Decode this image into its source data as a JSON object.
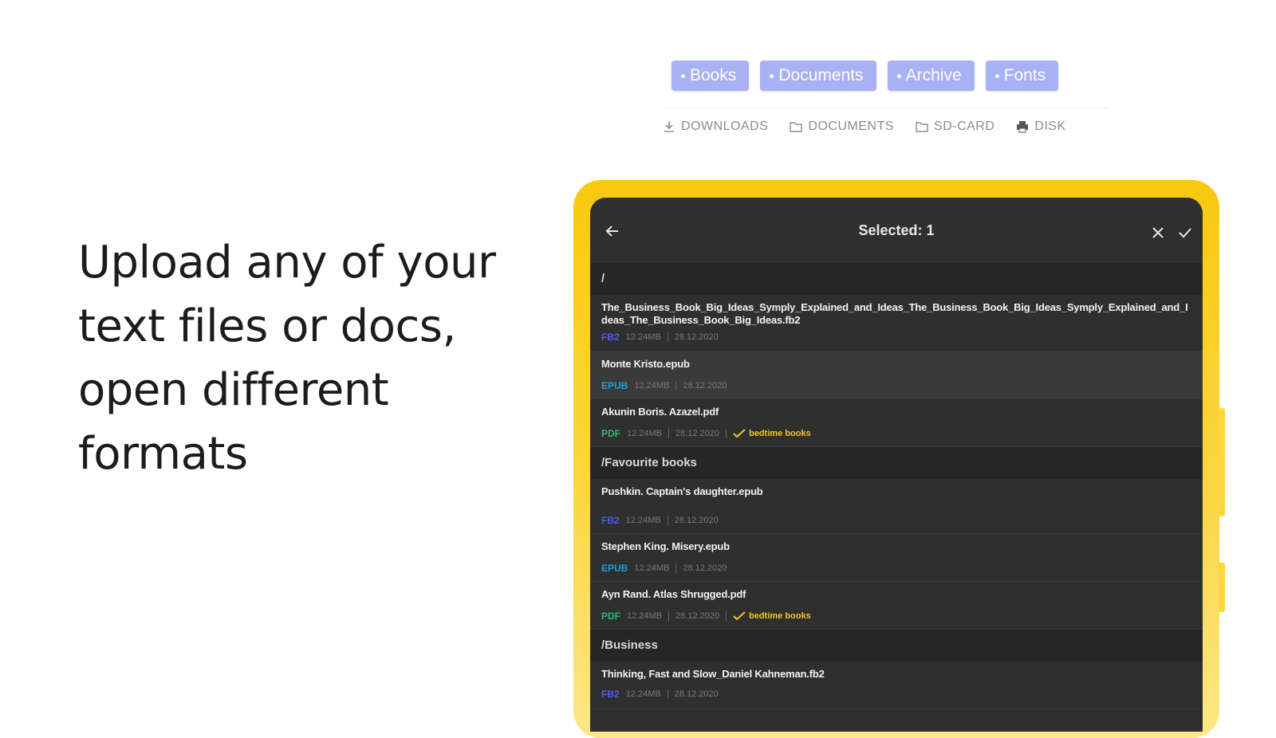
{
  "headline": {
    "lines": [
      "Upload any of your",
      "text files or docs,",
      "open different",
      "formats"
    ]
  },
  "categories": [
    "Books",
    "Documents",
    "Archive",
    "Fonts"
  ],
  "locations": [
    {
      "label": "DOWNLOADS",
      "icon": "download-icon"
    },
    {
      "label": "DOCUMENTS",
      "icon": "folder-icon"
    },
    {
      "label": "SD-CARD",
      "icon": "folder-icon"
    },
    {
      "label": "DISK",
      "icon": "printer-icon"
    }
  ],
  "app": {
    "title": "Selected: 1",
    "sections": [
      {
        "path": "/",
        "files": [
          {
            "name": "The_Business_Book_Big_Ideas_Symply_Explained_and_Ideas_The_Business_Book_Big_Ideas_Symply_Explained_and_Ideas_The_Business_Book_Big_Ideas.fb2",
            "format": "FB2",
            "size": "12.24MB",
            "date": "28.12.2020",
            "badge": ""
          },
          {
            "name": "Monte Kristo.epub",
            "format": "EPUB",
            "size": "12.24MB",
            "date": "28.12.2020",
            "badge": ""
          },
          {
            "name": "Akunin Boris. Azazel.pdf",
            "format": "PDF",
            "size": "12.24MB",
            "date": "28.12.2020",
            "badge": "bedtime books"
          }
        ]
      },
      {
        "path": "/Favourite books",
        "files": [
          {
            "name": "Pushkin. Captain's daughter.epub",
            "format": "FB2",
            "size": "12.24MB",
            "date": "28.12.2020",
            "badge": ""
          },
          {
            "name": "Stephen King. Misery.epub",
            "format": "EPUB",
            "size": "12.24MB",
            "date": "28.12.2020",
            "badge": ""
          },
          {
            "name": "Ayn Rand. Atlas Shrugged.pdf",
            "format": "PDF",
            "size": "12.24MB",
            "date": "28.12.2020",
            "badge": "bedtime books"
          }
        ]
      },
      {
        "path": "/Business",
        "files": [
          {
            "name": "Thinking, Fast and Slow_Daniel Kahneman.fb2",
            "format": "FB2",
            "size": "12.24MB",
            "date": "28.12.2020",
            "badge": ""
          }
        ]
      }
    ]
  },
  "colors": {
    "chip": "#a8b1f3",
    "frame": "#f9c80e",
    "screen": "#2f2f2f",
    "fb2": "#4c5cf0",
    "epub": "#1da0d8",
    "pdf": "#2bb673",
    "badge": "#f6c324"
  }
}
